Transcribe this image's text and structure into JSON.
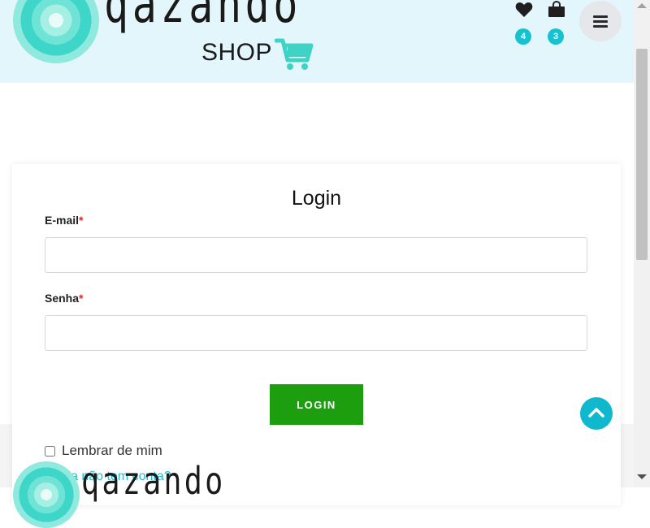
{
  "brand": {
    "name": "qazando",
    "subtitle": "SHOP"
  },
  "header": {
    "wishlist_count": "4",
    "cart_count": "3"
  },
  "login": {
    "title": "Login",
    "email_label": "E-mail",
    "password_label": "Senha",
    "required_mark": "*",
    "email_value": "",
    "password_value": "",
    "button_label": "LOGIN",
    "remember_label": "Lembrar de mim",
    "register_link": "Ainda não tem conta?"
  },
  "footer": {
    "brand_name": "qazando"
  },
  "colors": {
    "accent": "#14c3cf",
    "login_button": "#1d9e0e",
    "header_bg": "#e3f6fb",
    "required": "#e02b2b"
  },
  "icons": {
    "wishlist": "heart-icon",
    "cart": "shopping-bag-icon",
    "menu": "hamburger-menu-icon",
    "back_to_top": "chevron-up-icon",
    "logo_cart": "shopping-cart-icon"
  }
}
